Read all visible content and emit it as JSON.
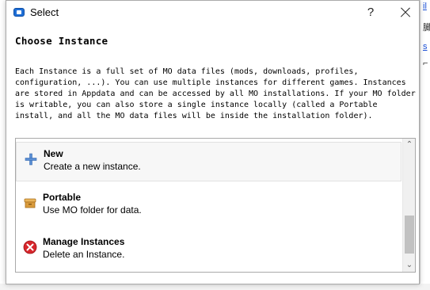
{
  "window": {
    "title": "Select",
    "help_label": "?"
  },
  "dialog": {
    "heading": "Choose Instance",
    "description": "Each Instance is a full set of MO data files (mods, downloads, profiles,\nconfiguration, ...). You can use multiple instances for different games. Instances\nare stored in Appdata and can be accessed by all MO installations. If your MO folder\nis writable, you can also store a single instance locally (called a Portable\ninstall, and all the MO data files will be inside the installation folder)."
  },
  "options": [
    {
      "title": "New",
      "subtitle": "Create a new instance.",
      "icon": "plus-icon",
      "selected": true
    },
    {
      "title": "Portable",
      "subtitle": "Use MO folder for data.",
      "icon": "box-icon",
      "selected": false
    },
    {
      "title": "Manage Instances",
      "subtitle": "Delete an Instance.",
      "icon": "delete-icon",
      "selected": false
    }
  ],
  "scrollbar": {
    "up_arrow": "⌃",
    "down_arrow": "⌄",
    "position": 0.75
  },
  "background": {
    "link_fragments": [
      "il",
      "臓",
      "s",
      "⌐"
    ]
  },
  "colors": {
    "accent": "#1f6fd6",
    "delete_red": "#d7262c",
    "box_orange": "#d99b3c"
  }
}
